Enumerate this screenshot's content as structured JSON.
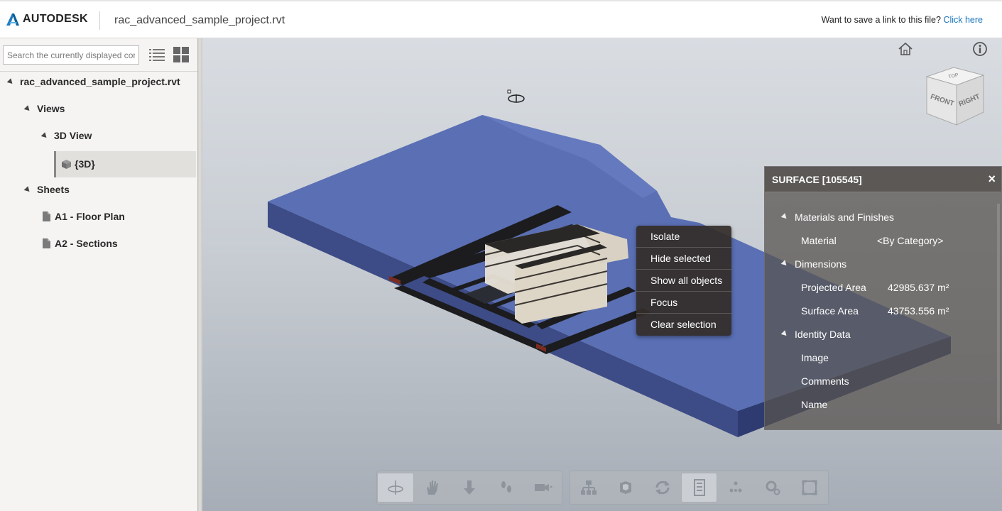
{
  "header": {
    "brand": "AUTODESK",
    "file_title": "rac_advanced_sample_project.rvt",
    "save_prompt": "Want to save a link to this file?",
    "save_link": "Click here"
  },
  "sidebar": {
    "search_placeholder": "Search the currently displayed cor",
    "tree": {
      "root": "rac_advanced_sample_project.rvt",
      "views_label": "Views",
      "view_3d_group": "3D View",
      "view_3d_item": "{3D}",
      "sheets_label": "Sheets",
      "sheet_1": "A1 - Floor Plan",
      "sheet_2": "A2 - Sections"
    }
  },
  "context_menu": {
    "items": [
      "Isolate",
      "Hide selected",
      "Show all objects",
      "Focus",
      "Clear selection"
    ]
  },
  "properties": {
    "title": "SURFACE [105545]",
    "close": "×",
    "cat_materials": "Materials and Finishes",
    "material_key": "Material",
    "material_val": "<By Category>",
    "cat_dimensions": "Dimensions",
    "proj_area_key": "Projected Area",
    "proj_area_val": "42985.637 m²",
    "surf_area_key": "Surface Area",
    "surf_area_val": "43753.556 m²",
    "cat_identity": "Identity Data",
    "image_key": "Image",
    "comments_key": "Comments",
    "name_key": "Name"
  },
  "viewcube": {
    "top": "TOP",
    "front": "FRONT",
    "right": "RIGHT"
  },
  "colors": {
    "accent_link": "#1b75bb",
    "site_blue": "#5a6fb4",
    "menu_bg": "#342d2a"
  },
  "toolbar_left": [
    "orbit-icon",
    "pan-hand-icon",
    "zoom-arrow-icon",
    "walk-footsteps-icon",
    "camera-icon"
  ],
  "toolbar_right": [
    "model-structure-icon",
    "explode-icon",
    "section-refresh-icon",
    "properties-doc-icon",
    "measure-icon",
    "settings-gear-icon",
    "fullscreen-icon"
  ]
}
